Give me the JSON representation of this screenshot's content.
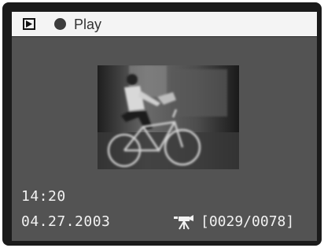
{
  "header": {
    "mode_icon": "play-mode-icon",
    "indicator_icon": "record-dot-icon",
    "mode_label": "Play"
  },
  "thumbnail": {
    "icon": "video-frame-cyclist",
    "alt": "Video frame of a cyclist"
  },
  "info": {
    "time": "14:20",
    "date": "04.27.2003",
    "movie_icon": "movie-camera-icon",
    "counter": "[0029/0078]"
  },
  "colors": {
    "screen_bg": "#535353",
    "bezel": "#1b1b1b",
    "header_bg": "#f4f4f4",
    "text": "#f2f2f2"
  }
}
